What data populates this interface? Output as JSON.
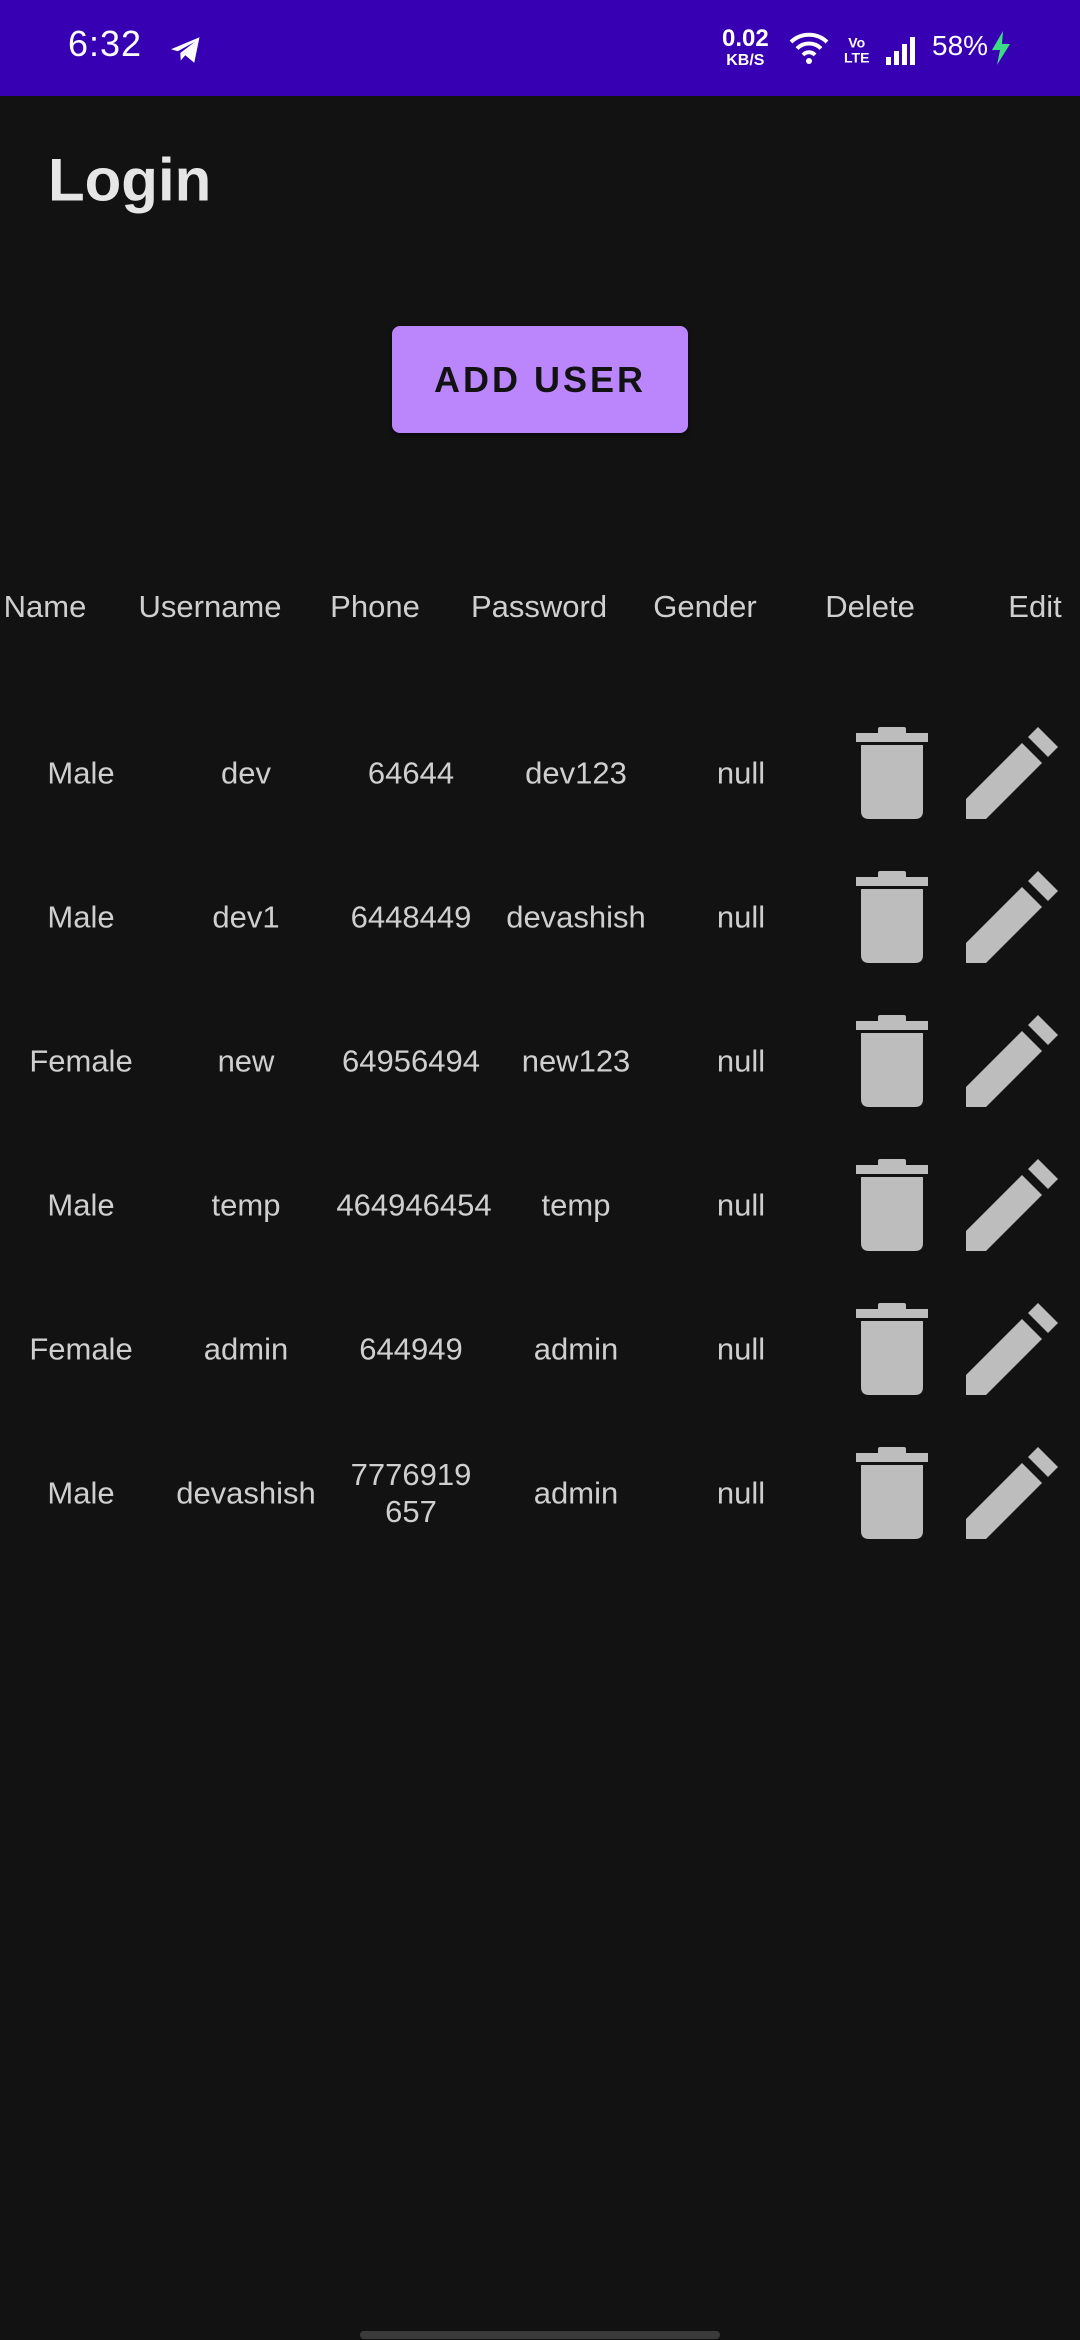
{
  "status_bar": {
    "time": "6:32",
    "net_speed_value": "0.02",
    "net_speed_unit": "KB/S",
    "volte_top": "Vo",
    "volte_bottom": "LTE",
    "battery": "58%"
  },
  "title": "Login",
  "add_user_label": "ADD USER",
  "table": {
    "headers": [
      "Name",
      "Username",
      "Phone",
      "Password",
      "Gender",
      "Delete",
      "Edit"
    ],
    "rows": [
      {
        "name": "Male",
        "username": "dev",
        "phone": "64644",
        "password": "dev123",
        "gender": "null"
      },
      {
        "name": "Male",
        "username": "dev1",
        "phone": "6448449",
        "password": "devashish",
        "gender": "null"
      },
      {
        "name": "Female",
        "username": "new",
        "phone": "64956494",
        "password": "new123",
        "gender": "null"
      },
      {
        "name": "Male",
        "username": "temp",
        "phone": "464946454",
        "password": "temp",
        "gender": "null"
      },
      {
        "name": "Female",
        "username": "admin",
        "phone": "644949",
        "password": "admin",
        "gender": "null"
      },
      {
        "name": "Male",
        "username": "devashish",
        "phone": "7776919657",
        "password": "admin",
        "gender": "null"
      }
    ]
  },
  "colors": {
    "status_bar": "#3700b3",
    "background": "#121212",
    "accent": "#bb86fc",
    "icon": "#bdbdbd"
  }
}
